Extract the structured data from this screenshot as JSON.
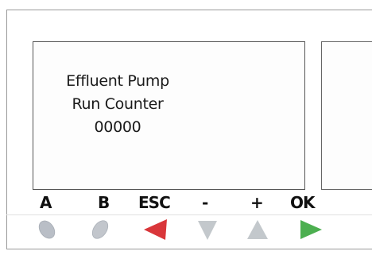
{
  "screen": {
    "line1": "Effluent Pump",
    "line2": "Run Counter",
    "line3": "00000"
  },
  "buttons": [
    {
      "label": "A",
      "icon": "oval-button-icon",
      "color": "#b9bec6"
    },
    {
      "label": "B",
      "icon": "oval-button-icon",
      "color": "#c2c6cc"
    },
    {
      "label": "ESC",
      "icon": "left-arrow-icon",
      "color": "#d9363a"
    },
    {
      "label": "-",
      "icon": "down-arrow-icon",
      "color": "#c3c8cc"
    },
    {
      "label": "+",
      "icon": "up-arrow-icon",
      "color": "#c3c8cc"
    },
    {
      "label": "OK",
      "icon": "right-arrow-icon",
      "color": "#4caf50"
    }
  ]
}
